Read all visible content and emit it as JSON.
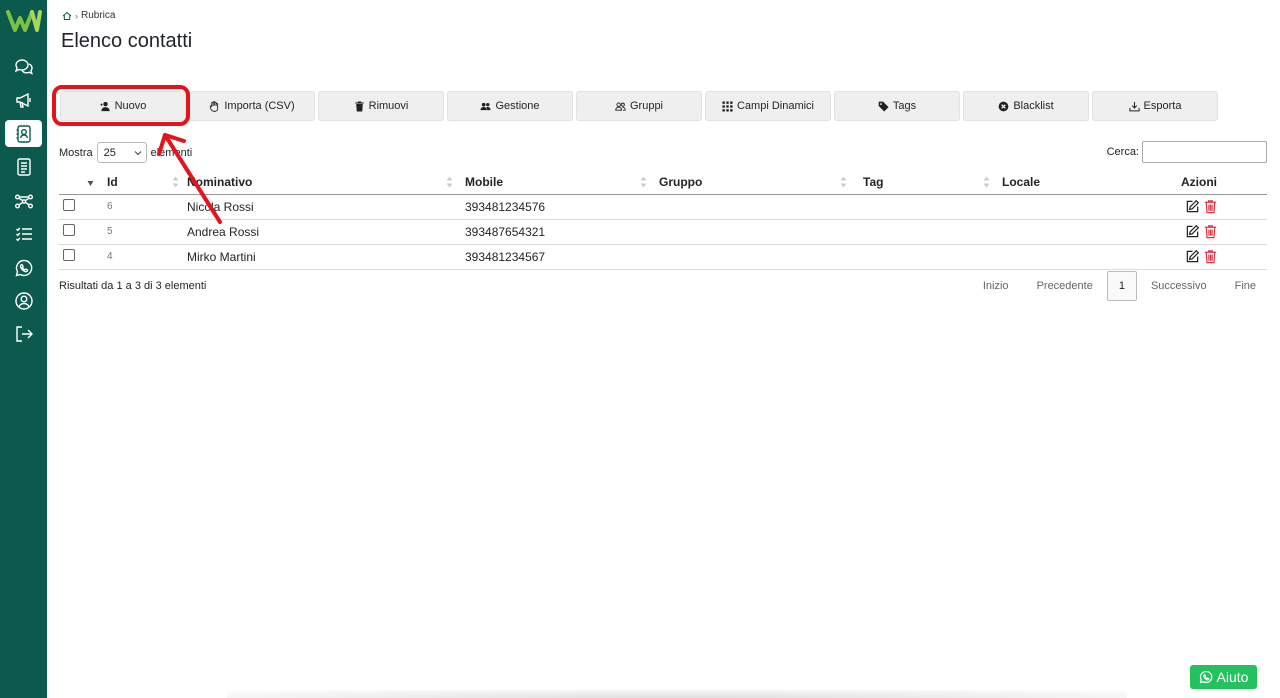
{
  "breadcrumb": {
    "current": "Rubrica"
  },
  "page": {
    "title": "Elenco contatti"
  },
  "toolbar": [
    {
      "label": "Nuovo",
      "icon": "user-plus-icon"
    },
    {
      "label": "Importa (CSV)",
      "icon": "hand-icon"
    },
    {
      "label": "Rimuovi",
      "icon": "trash-icon"
    },
    {
      "label": "Gestione",
      "icon": "users-icon"
    },
    {
      "label": "Gruppi",
      "icon": "group-icon"
    },
    {
      "label": "Campi Dinamici",
      "icon": "grid-icon"
    },
    {
      "label": "Tags",
      "icon": "tag-icon"
    },
    {
      "label": "Blacklist",
      "icon": "block-icon"
    },
    {
      "label": "Esporta",
      "icon": "download-icon"
    }
  ],
  "list_controls": {
    "show_prefix": "Mostra",
    "show_value": "25",
    "show_suffix": "elementi",
    "search_label": "Cerca:",
    "search_value": ""
  },
  "table": {
    "columns": [
      "Id",
      "Nominativo",
      "Mobile",
      "Gruppo",
      "Tag",
      "Locale",
      "Azioni"
    ],
    "rows": [
      {
        "id": "6",
        "name": "Nicola Rossi",
        "mobile": "393481234576",
        "group": "",
        "tag": "",
        "locale": ""
      },
      {
        "id": "5",
        "name": "Andrea Rossi",
        "mobile": "393487654321",
        "group": "",
        "tag": "",
        "locale": ""
      },
      {
        "id": "4",
        "name": "Mirko Martini",
        "mobile": "393481234567",
        "group": "",
        "tag": "",
        "locale": ""
      }
    ]
  },
  "summary": "Risultati da 1 a 3 di 3 elementi",
  "pagination": {
    "first": "Inizio",
    "prev": "Precedente",
    "current": "1",
    "next": "Successivo",
    "last": "Fine"
  },
  "help": {
    "label": "Aiuto"
  },
  "colors": {
    "sidebar": "#0b5a4d",
    "annotation": "#e4141b",
    "help": "#25c15f",
    "delete": "#dc3545"
  }
}
